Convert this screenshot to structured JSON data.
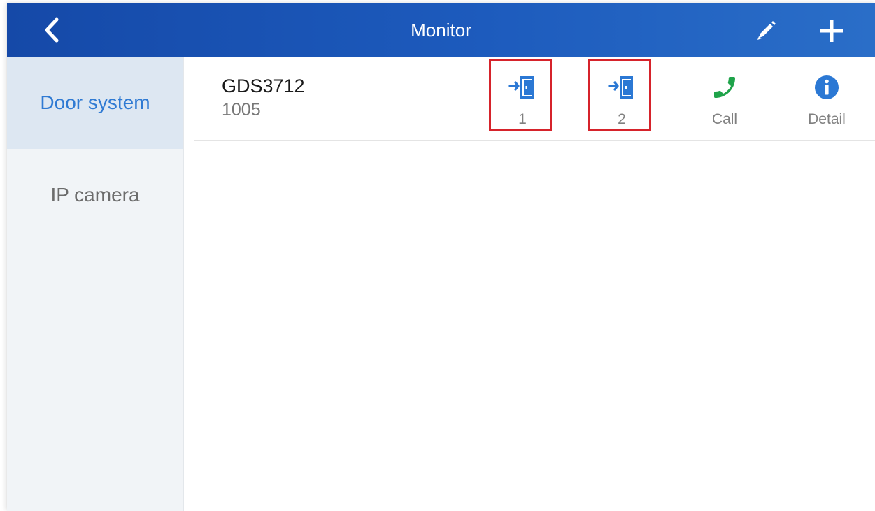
{
  "header": {
    "title": "Monitor",
    "back_icon": "chevron-left-icon",
    "edit_icon": "pencil-icon",
    "add_icon": "plus-icon"
  },
  "sidebar": {
    "items": [
      {
        "label": "Door system",
        "active": true
      },
      {
        "label": "IP camera",
        "active": false
      }
    ]
  },
  "devices": [
    {
      "name": "GDS3712",
      "number": "1005",
      "actions": [
        {
          "label": "1",
          "icon": "door-open-icon",
          "highlighted": true
        },
        {
          "label": "2",
          "icon": "door-open-icon",
          "highlighted": true
        },
        {
          "label": "Call",
          "icon": "phone-icon",
          "highlighted": false
        },
        {
          "label": "Detail",
          "icon": "info-icon",
          "highlighted": false
        }
      ]
    }
  ],
  "colors": {
    "header_bg": "#1d5bbd",
    "accent_blue": "#2f7ad3",
    "call_green": "#1fa34a",
    "highlight_red": "#d6232b"
  }
}
